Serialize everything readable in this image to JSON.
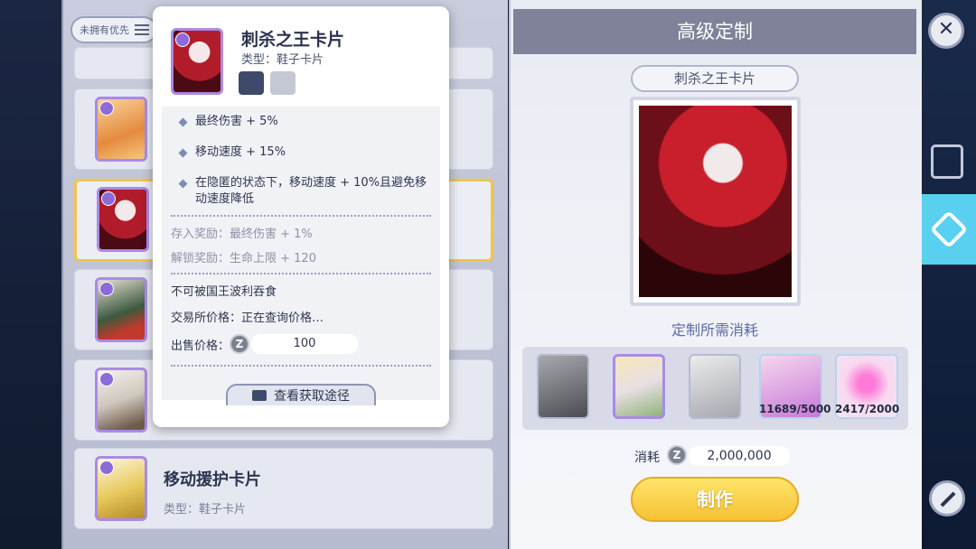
{
  "sort_button": {
    "label": "未拥有优先"
  },
  "card_list": [
    {
      "name": "",
      "type": ""
    },
    {
      "name": "",
      "type": ""
    },
    {
      "name": "",
      "type": ""
    },
    {
      "name": "",
      "type": ""
    },
    {
      "name": "",
      "type": ""
    },
    {
      "name": "移动援护卡片",
      "type": "类型：鞋子卡片"
    }
  ],
  "popup": {
    "title": "刺杀之王卡片",
    "type": "类型：鞋子卡片",
    "effects": [
      "最终伤害 + 5%",
      "移动速度 + 15%",
      "在隐匿的状态下，移动速度 + 10%且避免移动速度降低"
    ],
    "deposit_reward": "存入奖励：最终伤害 + 1%",
    "unlock_reward": "解锁奖励：生命上限 + 120",
    "note": "不可被国王波利吞食",
    "market_price": "交易所价格：正在查询价格…",
    "sell_label": "出售价格：",
    "sell_value": "100",
    "coin_symbol": "Z",
    "query_button": "查看获取途径"
  },
  "craft": {
    "header": "高级定制",
    "card_name": "刺杀之王卡片",
    "cost_title": "定制所需消耗",
    "materials": [
      {
        "count": ""
      },
      {
        "count": ""
      },
      {
        "count": ""
      },
      {
        "count": "11689/5000"
      },
      {
        "count": "2417/2000"
      }
    ],
    "cost_label": "消耗",
    "cost_value": "2,000,000",
    "make_button": "制作"
  },
  "side": {
    "close": "✕"
  }
}
